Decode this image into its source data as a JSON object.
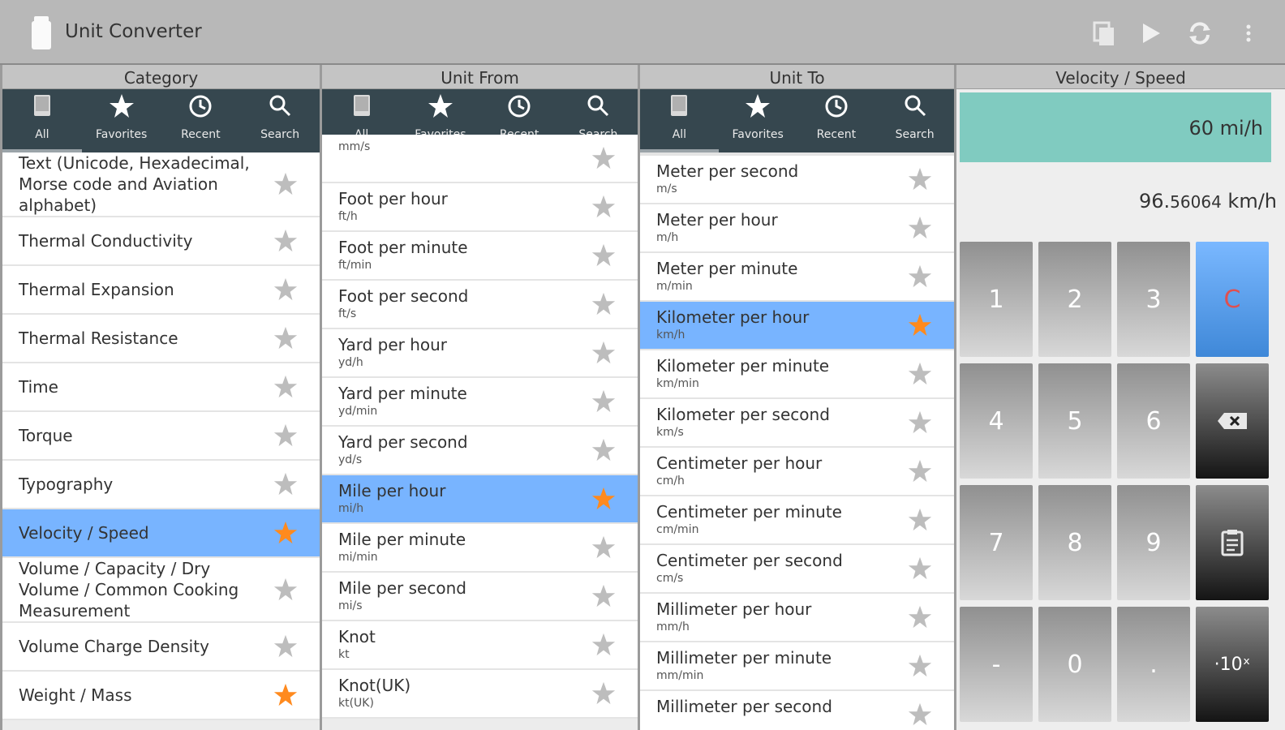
{
  "app": {
    "title": "Unit Converter",
    "icons": [
      "copy-icon",
      "play-icon",
      "swap-icon",
      "more-vert-icon"
    ]
  },
  "tab_labels": [
    "All",
    "Favorites",
    "Recent",
    "Search"
  ],
  "category": {
    "header": "Category",
    "items": [
      {
        "name": "Text (Unicode, Hexadecimal, Morse code and Aviation alphabet)",
        "fav": false,
        "selected": false
      },
      {
        "name": "Thermal Conductivity",
        "fav": false,
        "selected": false
      },
      {
        "name": "Thermal Expansion",
        "fav": false,
        "selected": false
      },
      {
        "name": "Thermal Resistance",
        "fav": false,
        "selected": false
      },
      {
        "name": "Time",
        "fav": false,
        "selected": false
      },
      {
        "name": "Torque",
        "fav": false,
        "selected": false
      },
      {
        "name": "Typography",
        "fav": false,
        "selected": false
      },
      {
        "name": "Velocity / Speed",
        "fav": true,
        "selected": true
      },
      {
        "name": "Volume / Capacity / Dry Volume / Common Cooking Measurement",
        "fav": false,
        "selected": false
      },
      {
        "name": "Volume Charge Density",
        "fav": false,
        "selected": false
      },
      {
        "name": "Weight / Mass",
        "fav": true,
        "selected": false
      }
    ]
  },
  "unit_from": {
    "header": "Unit From",
    "items": [
      {
        "name": "",
        "abbr": "mm/s",
        "fav": false,
        "selected": false
      },
      {
        "name": "Foot per hour",
        "abbr": "ft/h",
        "fav": false,
        "selected": false
      },
      {
        "name": "Foot per minute",
        "abbr": "ft/min",
        "fav": false,
        "selected": false
      },
      {
        "name": "Foot per second",
        "abbr": "ft/s",
        "fav": false,
        "selected": false
      },
      {
        "name": "Yard per hour",
        "abbr": "yd/h",
        "fav": false,
        "selected": false
      },
      {
        "name": "Yard per minute",
        "abbr": "yd/min",
        "fav": false,
        "selected": false
      },
      {
        "name": "Yard per second",
        "abbr": "yd/s",
        "fav": false,
        "selected": false
      },
      {
        "name": "Mile per hour",
        "abbr": "mi/h",
        "fav": true,
        "selected": true
      },
      {
        "name": "Mile per minute",
        "abbr": "mi/min",
        "fav": false,
        "selected": false
      },
      {
        "name": "Mile per second",
        "abbr": "mi/s",
        "fav": false,
        "selected": false
      },
      {
        "name": "Knot",
        "abbr": "kt",
        "fav": false,
        "selected": false
      },
      {
        "name": "Knot(UK)",
        "abbr": "kt(UK)",
        "fav": false,
        "selected": false
      }
    ]
  },
  "unit_to": {
    "header": "Unit To",
    "items": [
      {
        "name": "Meter per second",
        "abbr": "m/s",
        "fav": false,
        "selected": false
      },
      {
        "name": "Meter per hour",
        "abbr": "m/h",
        "fav": false,
        "selected": false
      },
      {
        "name": "Meter per minute",
        "abbr": "m/min",
        "fav": false,
        "selected": false
      },
      {
        "name": "Kilometer per hour",
        "abbr": "km/h",
        "fav": true,
        "selected": true
      },
      {
        "name": "Kilometer per minute",
        "abbr": "km/min",
        "fav": false,
        "selected": false
      },
      {
        "name": "Kilometer per second",
        "abbr": "km/s",
        "fav": false,
        "selected": false
      },
      {
        "name": "Centimeter per hour",
        "abbr": "cm/h",
        "fav": false,
        "selected": false
      },
      {
        "name": "Centimeter per minute",
        "abbr": "cm/min",
        "fav": false,
        "selected": false
      },
      {
        "name": "Centimeter per second",
        "abbr": "cm/s",
        "fav": false,
        "selected": false
      },
      {
        "name": "Millimeter per hour",
        "abbr": "mm/h",
        "fav": false,
        "selected": false
      },
      {
        "name": "Millimeter per minute",
        "abbr": "mm/min",
        "fav": false,
        "selected": false
      },
      {
        "name": "Millimeter per second",
        "abbr": "",
        "fav": false,
        "selected": false
      }
    ]
  },
  "calculator": {
    "header": "Velocity / Speed",
    "input": "60 mi/h",
    "result_int": "96.",
    "result_frac": "56064",
    "result_unit": " km/h",
    "keys": [
      {
        "label": "1",
        "style": "gray",
        "name": "key-1"
      },
      {
        "label": "2",
        "style": "gray",
        "name": "key-2"
      },
      {
        "label": "3",
        "style": "gray",
        "name": "key-3"
      },
      {
        "label": "C",
        "style": "blue",
        "name": "clear-button"
      },
      {
        "label": "4",
        "style": "gray",
        "name": "key-4"
      },
      {
        "label": "5",
        "style": "gray",
        "name": "key-5"
      },
      {
        "label": "6",
        "style": "gray",
        "name": "key-6"
      },
      {
        "label": "",
        "style": "dark",
        "name": "backspace-button",
        "icon": "backspace-icon"
      },
      {
        "label": "7",
        "style": "gray",
        "name": "key-7"
      },
      {
        "label": "8",
        "style": "gray",
        "name": "key-8"
      },
      {
        "label": "9",
        "style": "gray",
        "name": "key-9"
      },
      {
        "label": "",
        "style": "dark",
        "name": "paste-button",
        "icon": "clipboard-icon"
      },
      {
        "label": "-",
        "style": "gray",
        "name": "key-minus"
      },
      {
        "label": "0",
        "style": "gray",
        "name": "key-0"
      },
      {
        "label": ".",
        "style": "gray",
        "name": "key-decimal"
      },
      {
        "label": "·10ˣ",
        "style": "dark",
        "name": "exponent-button"
      }
    ]
  },
  "colors": {
    "appbar": "#b8b8b8",
    "tabbar": "#36474f",
    "selected_row": "#78b4ff",
    "star_fav": "#ff8a1e",
    "star_default": "#bdbdbd",
    "display": "#80cbc0"
  }
}
